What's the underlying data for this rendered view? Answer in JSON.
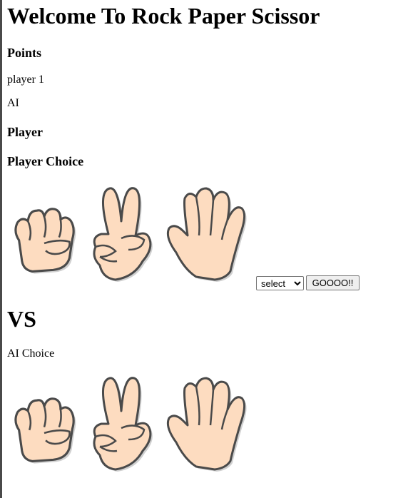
{
  "title": "Welcome To Rock Paper Scissor",
  "points": {
    "heading": "Points",
    "player_label": "player 1",
    "ai_label": "AI"
  },
  "player": {
    "heading": "Player",
    "choice_heading": "Player Choice"
  },
  "controls": {
    "select_value": "select",
    "go_label": "GOOOO!!"
  },
  "vs": "VS",
  "ai_choice_label": "AI Choice",
  "hands": [
    "rock-hand-icon",
    "scissors-hand-icon",
    "paper-hand-icon"
  ],
  "colors": {
    "skin": "#fddcc0",
    "outline": "#4a4a4a",
    "shadow": "#d0d0d0"
  }
}
